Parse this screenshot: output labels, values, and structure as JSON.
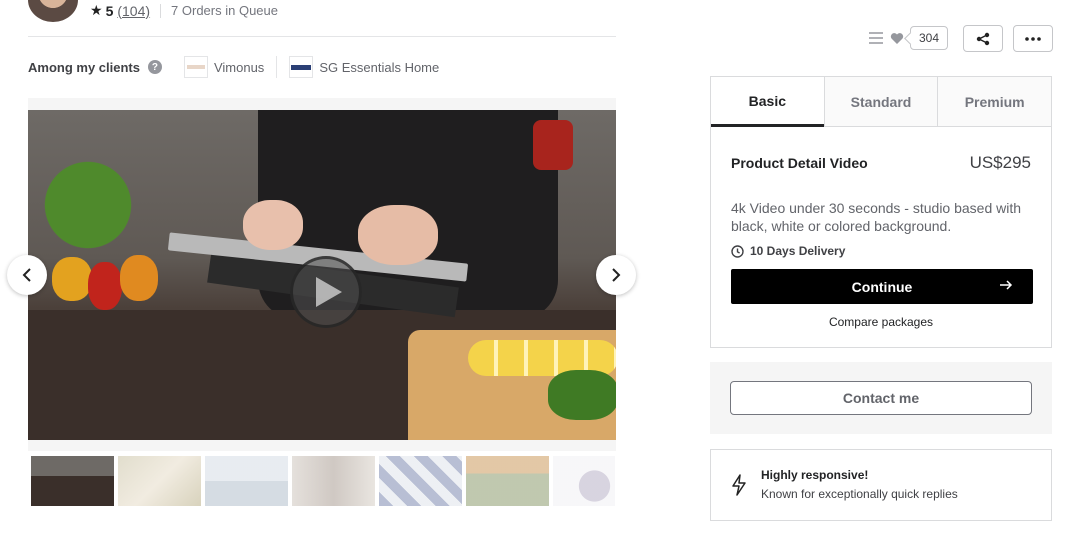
{
  "seller": {
    "rating_score": "5",
    "rating_count": "(104)",
    "queue_text": "7 Orders in Queue"
  },
  "clients": {
    "label": "Among my clients",
    "items": [
      {
        "name": "Vimonus"
      },
      {
        "name": "SG Essentials Home"
      }
    ]
  },
  "gallery": {
    "thumbnail_count": 7
  },
  "actions": {
    "save_count": "304"
  },
  "packages": {
    "tabs": [
      {
        "label": "Basic"
      },
      {
        "label": "Standard"
      },
      {
        "label": "Premium"
      }
    ],
    "selected_tab": "Basic",
    "title": "Product Detail Video",
    "price": "US$295",
    "description": "4k Video under 30 seconds - studio based with black, white or colored background.",
    "delivery": "10 Days Delivery",
    "continue_label": "Continue",
    "compare_label": "Compare packages"
  },
  "contact": {
    "label": "Contact me"
  },
  "responsive": {
    "title": "Highly responsive!",
    "subtitle": "Known for exceptionally quick replies"
  },
  "colors": {
    "primary_button": "#000000",
    "text": "#222325",
    "muted": "#62646a"
  }
}
